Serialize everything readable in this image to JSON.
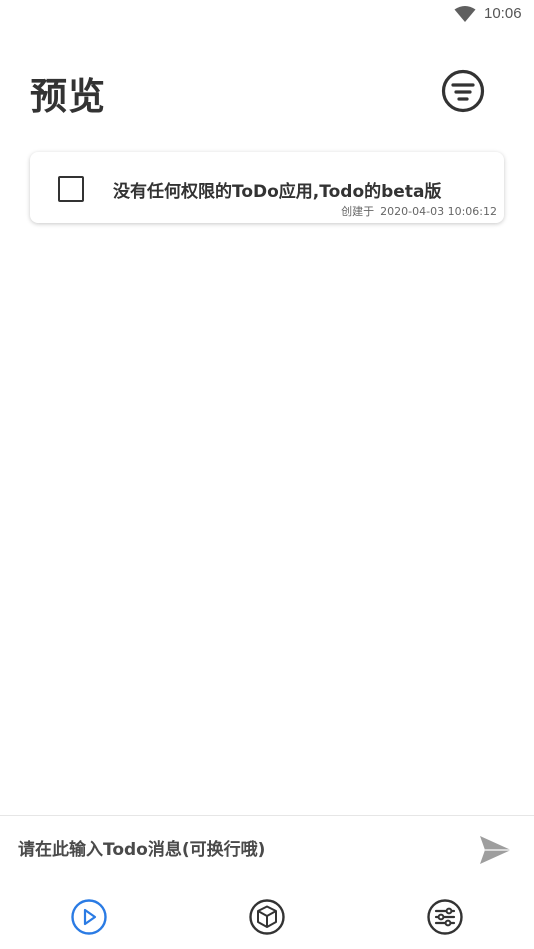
{
  "status_bar": {
    "time": "10:06",
    "icons": [
      "wifi-icon"
    ]
  },
  "header": {
    "title": "预览",
    "filter_icon": "filter-icon"
  },
  "todos": [
    {
      "text": "没有任何权限的ToDo应用,Todo的beta版",
      "created_label": "创建于",
      "created_at": "2020-04-03 10:06:12",
      "checked": false
    }
  ],
  "input": {
    "placeholder": "请在此输入Todo消息(可换行哦)",
    "value": "",
    "send_icon": "send-icon"
  },
  "nav": [
    {
      "icon": "play-circle-icon",
      "active": true
    },
    {
      "icon": "cube-icon",
      "active": false
    },
    {
      "icon": "sliders-circle-icon",
      "active": false
    }
  ],
  "colors": {
    "accent": "#2a7be4",
    "text": "#333333",
    "send": "#9e9e9e"
  }
}
